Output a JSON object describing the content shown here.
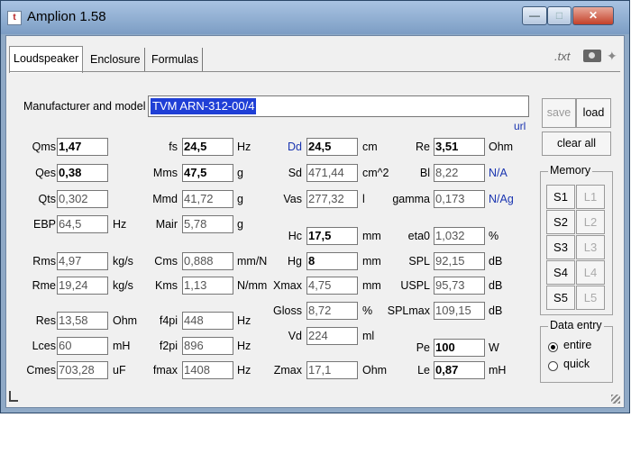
{
  "window": {
    "title": "Amplion 1.58",
    "app_icon": "t"
  },
  "tabs": [
    "Loudspeaker",
    "Enclosure",
    "Formulas"
  ],
  "toolbar": {
    "txt_label": ".txt"
  },
  "model": {
    "label": "Manufacturer and model",
    "value": "TVM ARN-312-00/4",
    "url_label": "url"
  },
  "buttons": {
    "save": "save",
    "load": "load",
    "clear_all": "clear all"
  },
  "memory": {
    "title": "Memory",
    "slots": [
      "S1",
      "L1",
      "S2",
      "L2",
      "S3",
      "L3",
      "S4",
      "L4",
      "S5",
      "L5"
    ]
  },
  "data_entry": {
    "title": "Data entry",
    "options": [
      "entire",
      "quick"
    ],
    "selected": "entire"
  },
  "fields": {
    "Qms": "1,47",
    "Qes": "0,38",
    "Qts": "0,302",
    "EBP": "64,5",
    "Rms": "4,97",
    "Rme": "19,24",
    "Res": "13,58",
    "Lces": "60",
    "Cmes": "703,28",
    "fs": "24,5",
    "Mms": "47,5",
    "Mmd": "41,72",
    "Mair": "5,78",
    "Cms": "0,888",
    "Kms": "1,13",
    "f4pi": "448",
    "f2pi": "896",
    "fmax": "1408",
    "Dd": "24,5",
    "Sd": "471,44",
    "Vas": "277,32",
    "Hc": "17,5",
    "Hg": "8",
    "Xmax": "4,75",
    "Gloss": "8,72",
    "Vd": "224",
    "Zmax": "17,1",
    "Re": "3,51",
    "Bl": "8,22",
    "gamma": "0,173",
    "eta0": "1,032",
    "SPL": "92,15",
    "USPL": "95,73",
    "SPLmax": "109,15",
    "Pe": "100",
    "Le": "0,87"
  },
  "labels": {
    "Qms": "Qms",
    "Qes": "Qes",
    "Qts": "Qts",
    "EBP": "EBP",
    "Rms": "Rms",
    "Rme": "Rme",
    "Res": "Res",
    "Lces": "Lces",
    "Cmes": "Cmes",
    "fs": "fs",
    "Mms": "Mms",
    "Mmd": "Mmd",
    "Mair": "Mair",
    "Cms": "Cms",
    "Kms": "Kms",
    "f4pi": "f4pi",
    "f2pi": "f2pi",
    "fmax": "fmax",
    "Dd": "Dd",
    "Sd": "Sd",
    "Vas": "Vas",
    "Hc": "Hc",
    "Hg": "Hg",
    "Xmax": "Xmax",
    "Gloss": "Gloss",
    "Vd": "Vd",
    "Zmax": "Zmax",
    "Re": "Re",
    "Bl": "Bl",
    "gamma": "gamma",
    "eta0": "eta0",
    "SPL": "SPL",
    "USPL": "USPL",
    "SPLmax": "SPLmax",
    "Pe": "Pe",
    "Le": "Le"
  },
  "units": {
    "EBP": "Hz",
    "Rms": "kg/s",
    "Rme": "kg/s",
    "Res": "Ohm",
    "Lces": "mH",
    "Cmes": "uF",
    "fs": "Hz",
    "Mms": "g",
    "Mmd": "g",
    "Mair": "g",
    "Cms": "mm/N",
    "Kms": "N/mm",
    "f4pi": "Hz",
    "f2pi": "Hz",
    "fmax": "Hz",
    "Dd": "cm",
    "Sd": "cm^2",
    "Vas": "l",
    "Hc": "mm",
    "Hg": "mm",
    "Xmax": "mm",
    "Gloss": "%",
    "Vd": "ml",
    "Zmax": "Ohm",
    "Re": "Ohm",
    "Bl": "N/A",
    "gamma": "N/Ag",
    "eta0": "%",
    "SPL": "dB",
    "USPL": "dB",
    "SPLmax": "dB",
    "Pe": "W",
    "Le": "mH"
  }
}
